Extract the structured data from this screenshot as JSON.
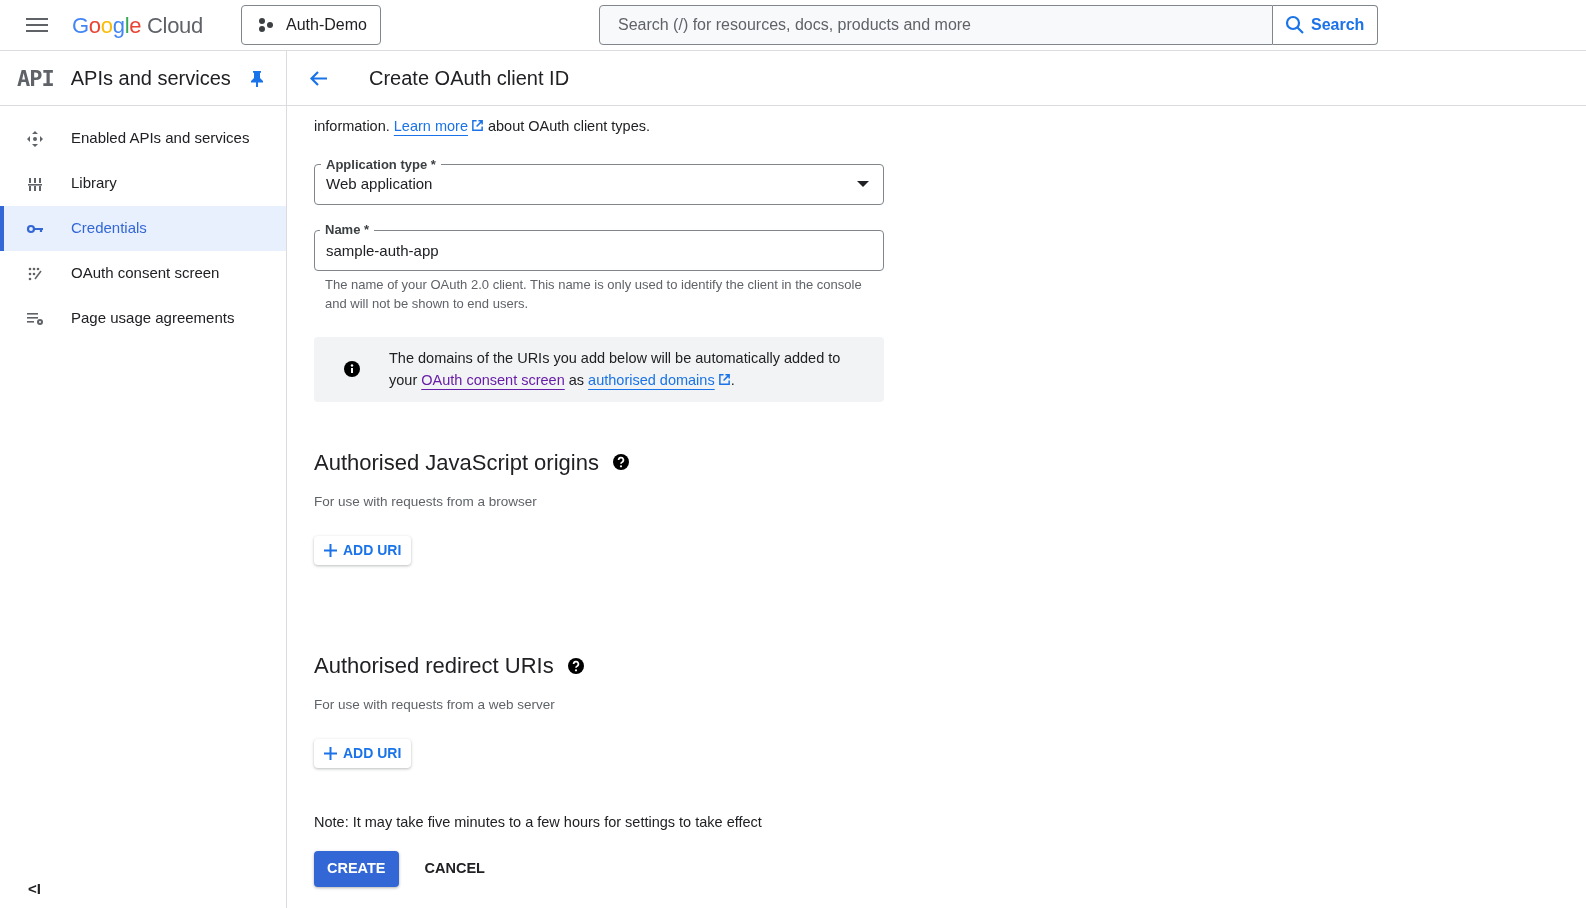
{
  "top_bar": {
    "logo": "Google Cloud",
    "project": "Auth-Demo",
    "search": {
      "placeholder": "Search (/) for resources, docs, products and more"
    },
    "search_button": "Search"
  },
  "sidebar": {
    "badge": "API",
    "title": "APIs and services",
    "items": [
      {
        "label": "Enabled APIs and services",
        "selected": false
      },
      {
        "label": "Library",
        "selected": false
      },
      {
        "label": "Credentials",
        "selected": true
      },
      {
        "label": "OAuth consent screen",
        "selected": false
      },
      {
        "label": "Page usage agreements",
        "selected": false
      }
    ],
    "collapse": "<I"
  },
  "page": {
    "title": "Create OAuth client ID",
    "intro": {
      "before": "information.",
      "link": "Learn more",
      "after": "about OAuth client types."
    },
    "application_type": {
      "label": "Application type *",
      "value": "Web application"
    },
    "name": {
      "label": "Name *",
      "value": "sample-auth-app",
      "help": "The name of your OAuth 2.0 client. This name is only used to identify the client in the console and will not be shown to end users."
    },
    "info": {
      "line1": "The domains of the URIs you add below will be automatically added to",
      "before": "your",
      "link1": "OAuth consent screen",
      "middle": "as",
      "link2": "authorised domains",
      "end": "."
    },
    "sections": [
      {
        "title": "Authorised JavaScript origins",
        "subtitle": "For use with requests from a browser",
        "button": "ADD URI"
      },
      {
        "title": "Authorised redirect URIs",
        "subtitle": "For use with requests from a web server",
        "button": "ADD URI"
      }
    ],
    "note": "Note: It may take five minutes to a few hours for settings to take effect",
    "create": "CREATE",
    "cancel": "CANCEL"
  }
}
